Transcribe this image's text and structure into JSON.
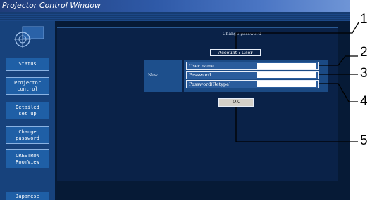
{
  "window": {
    "title": "Projector Control Window"
  },
  "sidebar": {
    "items": [
      {
        "label": "Status"
      },
      {
        "label": "Projector\ncontrol"
      },
      {
        "label": "Detailed\nset up"
      },
      {
        "label": "Change\npassword"
      },
      {
        "label": "CRESTRON\nRoomView"
      },
      {
        "label": "Japanese"
      }
    ]
  },
  "main": {
    "page_title": "Change password",
    "account": "Account : User",
    "new_label": "New",
    "fields": [
      {
        "label": "User name",
        "value": ""
      },
      {
        "label": "Password",
        "value": ""
      },
      {
        "label": "Password(Retype)",
        "value": ""
      }
    ],
    "ok_label": "OK"
  },
  "callouts": [
    "1",
    "2",
    "3",
    "4",
    "5"
  ]
}
